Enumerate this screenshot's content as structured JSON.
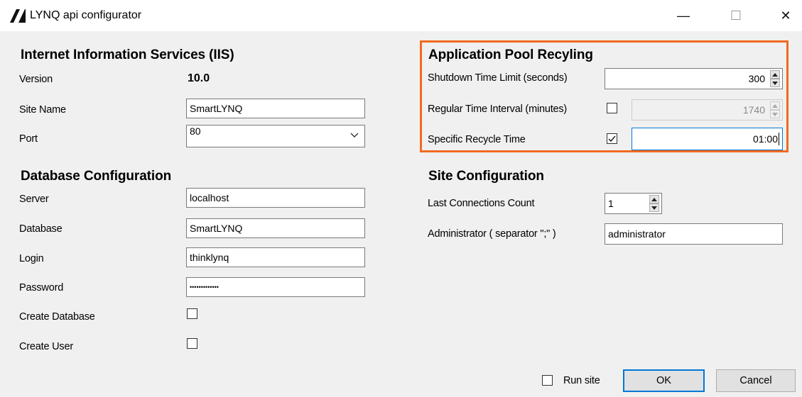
{
  "window": {
    "title": "LYNQ api configurator",
    "controls": {
      "minimize": "—",
      "maximize": "☐",
      "close": "✕"
    }
  },
  "iis": {
    "title": "Internet Information Services (IIS)",
    "version_label": "Version",
    "version_value": "10.0",
    "site_name_label": "Site Name",
    "site_name_value": "SmartLYNQ",
    "port_label": "Port",
    "port_value": "80"
  },
  "database": {
    "title": "Database Configuration",
    "server_label": "Server",
    "server_value": "localhost",
    "database_label": "Database",
    "database_value": "SmartLYNQ",
    "login_label": "Login",
    "login_value": "thinklynq",
    "password_label": "Password",
    "password_value": "•••••••••••••",
    "create_database_label": "Create Database",
    "create_database_checked": false,
    "create_user_label": "Create User",
    "create_user_checked": false
  },
  "app_pool": {
    "title": "Application Pool Recyling",
    "shutdown_label": "Shutdown Time Limit (seconds)",
    "shutdown_value": "300",
    "regular_label": "Regular Time Interval (minutes)",
    "regular_checked": false,
    "regular_value": "1740",
    "specific_label": "Specific Recycle Time",
    "specific_checked": true,
    "specific_value": "01:00",
    "highlight_color": "#f26a21"
  },
  "site": {
    "title": "Site Configuration",
    "last_conn_label": "Last Connections Count",
    "last_conn_value": "1",
    "admin_label": "Administrator ( separator \";\" )",
    "admin_value": "administrator"
  },
  "footer": {
    "run_site_label": "Run site",
    "run_site_checked": false,
    "ok_label": "OK",
    "cancel_label": "Cancel"
  },
  "colors": {
    "accent": "#0078d7",
    "window_bg": "#f0f0f0"
  }
}
